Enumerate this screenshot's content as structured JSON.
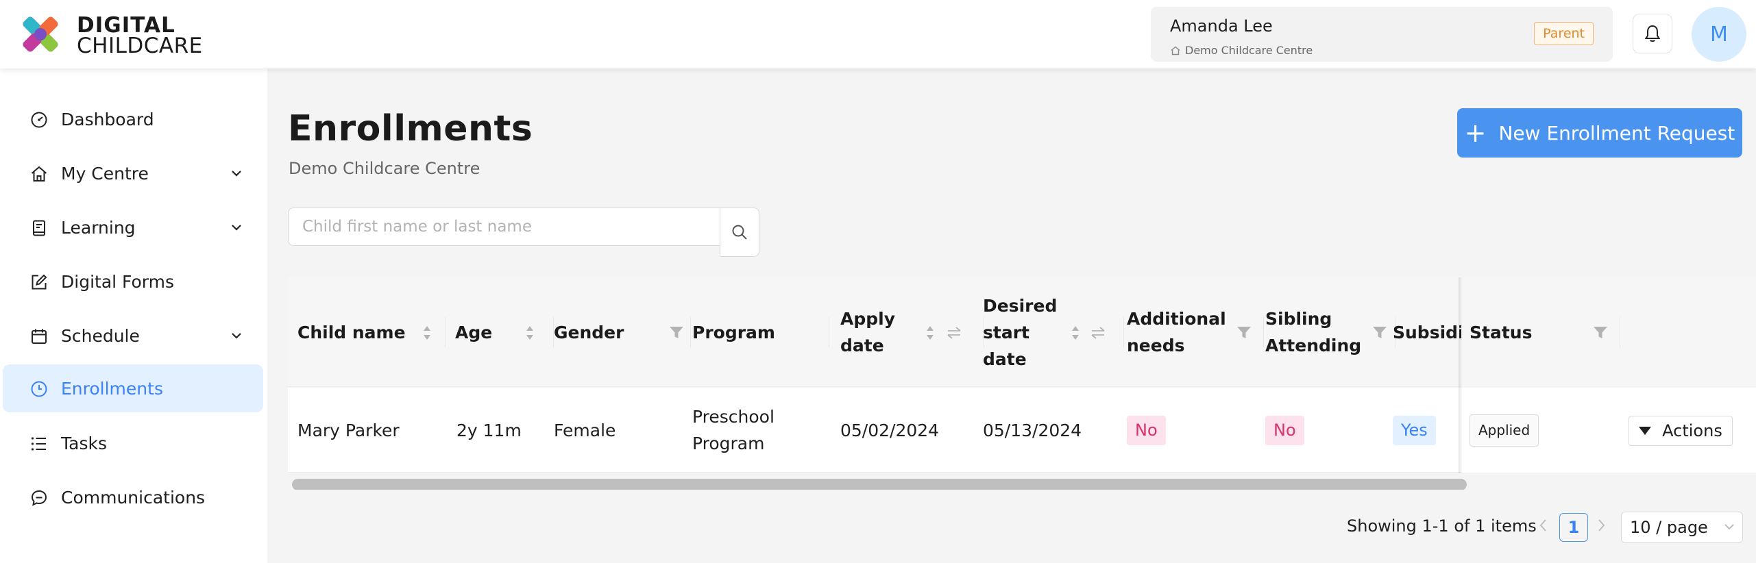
{
  "brand": {
    "line1": "DIGITAL",
    "line2": "CHILDCARE"
  },
  "user": {
    "name": "Amanda Lee",
    "centre": "Demo Childcare Centre",
    "role": "Parent",
    "avatar_initial": "M"
  },
  "sidebar": {
    "items": [
      {
        "label": "Dashboard",
        "icon": "dashboard-icon",
        "has_children": false,
        "active": false
      },
      {
        "label": "My Centre",
        "icon": "home-icon",
        "has_children": true,
        "active": false
      },
      {
        "label": "Learning",
        "icon": "book-icon",
        "has_children": true,
        "active": false
      },
      {
        "label": "Digital Forms",
        "icon": "form-edit-icon",
        "has_children": false,
        "active": false
      },
      {
        "label": "Schedule",
        "icon": "calendar-icon",
        "has_children": true,
        "active": false
      },
      {
        "label": "Enrollments",
        "icon": "enrollment-clock-icon",
        "has_children": false,
        "active": true
      },
      {
        "label": "Tasks",
        "icon": "list-icon",
        "has_children": false,
        "active": false
      },
      {
        "label": "Communications",
        "icon": "chat-icon",
        "has_children": false,
        "active": false
      }
    ]
  },
  "page": {
    "title": "Enrollments",
    "subtitle": "Demo Childcare Centre",
    "new_button_label": "New Enrollment Request"
  },
  "search": {
    "placeholder": "Child first name or last name",
    "value": ""
  },
  "table": {
    "columns": [
      {
        "label": "Child name",
        "controls": [
          "sort"
        ]
      },
      {
        "label": "Age",
        "controls": [
          "sort"
        ]
      },
      {
        "label": "Gender",
        "controls": [
          "filter"
        ]
      },
      {
        "label": "Program",
        "controls": []
      },
      {
        "label": "Apply date",
        "controls": [
          "sort",
          "swap"
        ]
      },
      {
        "label": "Desired start date",
        "controls": [
          "sort",
          "swap"
        ]
      },
      {
        "label": "Additional needs",
        "controls": [
          "filter"
        ]
      },
      {
        "label": "Sibling Attending",
        "controls": [
          "filter"
        ]
      },
      {
        "label": "Subsidiz",
        "controls": []
      },
      {
        "label": "Status",
        "controls": [
          "filter"
        ]
      },
      {
        "label": "",
        "controls": []
      }
    ],
    "rows": [
      {
        "child_name": "Mary Parker",
        "age": "2y 11m",
        "gender": "Female",
        "program": "Preschool Program",
        "apply_date": "05/02/2024",
        "desired_start_date": "05/13/2024",
        "additional_needs": "No",
        "sibling_attending": "No",
        "subsidized": "Yes",
        "status": "Applied",
        "actions_label": "Actions"
      }
    ]
  },
  "pagination": {
    "summary": "Showing 1-1 of 1 items",
    "current_page": "1",
    "page_size": "10 / page"
  },
  "colors": {
    "accent": "#4a94f0",
    "active_nav_bg": "#e3f0ff",
    "tag_no_bg": "#fde1ec",
    "tag_no_text": "#d6336c",
    "tag_yes_bg": "#e3f0ff",
    "role_badge": "#e58a2c"
  }
}
